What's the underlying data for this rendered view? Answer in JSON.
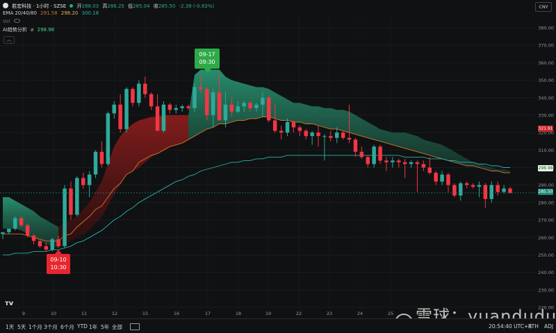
{
  "header": {
    "symbol_name": "胜宏科技 · 1小时 · SZSE",
    "open_label": "开",
    "open_value": "288.03",
    "high_label": "高",
    "high_value": "288.25",
    "low_label": "低",
    "low_value": "285.04",
    "close_label": "收",
    "close_value": "285.50",
    "change_value": "-2.38 (-0.83%)",
    "currency": "CNY"
  },
  "ema": {
    "label": "EMA 20/40/80",
    "v20": "291.58",
    "v40": "298.20",
    "v80": "300.18"
  },
  "vol_label": "Vol",
  "ai": {
    "label": "AI趋势分析",
    "value": "298.98"
  },
  "signals": [
    {
      "date": "09-17",
      "time": "09:30",
      "kind": "buy"
    },
    {
      "date": "09-10",
      "time": "10:30",
      "kind": "sell"
    }
  ],
  "price_badges": {
    "red": "321.91",
    "green": "298.98",
    "last": "285.50"
  },
  "bottom_bar": {
    "timeframes": [
      "1天",
      "5天",
      "1个月",
      "3个月",
      "6个月",
      "YTD",
      "1年",
      "5年",
      "全部"
    ],
    "time": "20:54:40 UTC+8",
    "session": "RTH",
    "adj": "ADJ"
  },
  "watermark": "雪球：yuandudu",
  "colors": {
    "up": "#2ea99a",
    "down": "#f23645",
    "ema20": "#d2772c",
    "ema80": "#26b3b0",
    "cloud_green": "#1f7a5f",
    "cloud_red": "#8a1d1d",
    "background": "#101112"
  },
  "chart_data": {
    "type": "candlestick",
    "x_tick_labels": [
      "9",
      "10",
      "11",
      "12",
      "15",
      "16",
      "17",
      "18",
      "19",
      "22",
      "23",
      "24",
      "25"
    ],
    "y_tick_labels": [
      "380.00",
      "370.00",
      "360.00",
      "350.00",
      "340.00",
      "330.00",
      "320.00",
      "310.00",
      "300.00",
      "290.00",
      "280.00",
      "270.00",
      "260.00",
      "250.00",
      "240.00",
      "230.00",
      "220.00"
    ],
    "ylim": [
      220,
      380
    ],
    "candles": [
      [
        262,
        263,
        259,
        263
      ],
      [
        263,
        265,
        262,
        265
      ],
      [
        265,
        272,
        264,
        271
      ],
      [
        271,
        272,
        266,
        267
      ],
      [
        267,
        268,
        260,
        261
      ],
      [
        261,
        262,
        256,
        258
      ],
      [
        258,
        258,
        254,
        255
      ],
      [
        255,
        257,
        252,
        253
      ],
      [
        253,
        260,
        252,
        259
      ],
      [
        259,
        261,
        254,
        255
      ],
      [
        255,
        290,
        254,
        288
      ],
      [
        288,
        292,
        270,
        273
      ],
      [
        273,
        295,
        272,
        294
      ],
      [
        294,
        297,
        288,
        290
      ],
      [
        290,
        298,
        283,
        296
      ],
      [
        296,
        310,
        294,
        309
      ],
      [
        309,
        315,
        300,
        302
      ],
      [
        302,
        332,
        301,
        331
      ],
      [
        331,
        338,
        328,
        336
      ],
      [
        336,
        342,
        320,
        322
      ],
      [
        322,
        346,
        320,
        345
      ],
      [
        345,
        346,
        335,
        337
      ],
      [
        337,
        350,
        335,
        348
      ],
      [
        348,
        352,
        340,
        342
      ],
      [
        342,
        343,
        333,
        335
      ],
      [
        335,
        342,
        321,
        321
      ],
      [
        321,
        338,
        320,
        336
      ],
      [
        336,
        337,
        331,
        333
      ],
      [
        333,
        336,
        331,
        334
      ],
      [
        334,
        336,
        332,
        335
      ],
      [
        335,
        336,
        333,
        334
      ],
      [
        334,
        348,
        332,
        346
      ],
      [
        346,
        353,
        343,
        345
      ],
      [
        345,
        346,
        327,
        330
      ],
      [
        330,
        345,
        323,
        343
      ],
      [
        343,
        353,
        327,
        327
      ],
      [
        327,
        343,
        323,
        336
      ],
      [
        336,
        340,
        329,
        332
      ],
      [
        332,
        338,
        331,
        335
      ],
      [
        335,
        338,
        332,
        337
      ],
      [
        337,
        338,
        332,
        334
      ],
      [
        334,
        337,
        332,
        336
      ],
      [
        336,
        343,
        329,
        340
      ],
      [
        340,
        341,
        326,
        327
      ],
      [
        327,
        336,
        320,
        321
      ],
      [
        321,
        324,
        316,
        320
      ],
      [
        320,
        328,
        318,
        326
      ],
      [
        326,
        327,
        320,
        323
      ],
      [
        323,
        324,
        318,
        321
      ],
      [
        321,
        322,
        316,
        318
      ],
      [
        318,
        321,
        313,
        320
      ],
      [
        320,
        324,
        312,
        318
      ],
      [
        318,
        319,
        304,
        318
      ],
      [
        318,
        321,
        315,
        317
      ],
      [
        317,
        323,
        314,
        320
      ],
      [
        320,
        321,
        316,
        317
      ],
      [
        317,
        336,
        314,
        316
      ],
      [
        316,
        317,
        306,
        309
      ],
      [
        309,
        312,
        305,
        306
      ],
      [
        306,
        307,
        300,
        302
      ],
      [
        302,
        313,
        300,
        312
      ],
      [
        312,
        313,
        302,
        304
      ],
      [
        304,
        306,
        298,
        303
      ],
      [
        303,
        306,
        300,
        304
      ],
      [
        304,
        305,
        300,
        303
      ],
      [
        303,
        305,
        294,
        302
      ],
      [
        302,
        304,
        300,
        303
      ],
      [
        303,
        304,
        286,
        302
      ],
      [
        302,
        304,
        298,
        300
      ],
      [
        300,
        306,
        296,
        297
      ],
      [
        297,
        298,
        290,
        292
      ],
      [
        292,
        298,
        290,
        296
      ],
      [
        296,
        297,
        286,
        290
      ],
      [
        290,
        291,
        283,
        284
      ],
      [
        284,
        292,
        281,
        291
      ],
      [
        291,
        292,
        288,
        290
      ],
      [
        290,
        291,
        288,
        289
      ],
      [
        289,
        292,
        283,
        290
      ],
      [
        290,
        291,
        277,
        282
      ],
      [
        282,
        292,
        280,
        290
      ],
      [
        290,
        292,
        284,
        286
      ],
      [
        286,
        290,
        285,
        288
      ],
      [
        288,
        289,
        285,
        285.5
      ]
    ],
    "ema20": [
      262,
      262,
      262,
      262,
      261,
      260,
      259,
      258,
      258,
      258,
      261,
      262,
      266,
      269,
      272,
      276,
      278,
      283,
      288,
      291,
      296,
      298,
      303,
      305,
      307,
      308,
      310,
      312,
      313,
      314,
      316,
      318,
      320,
      322,
      323,
      325,
      325,
      326,
      327,
      327,
      328,
      328,
      329,
      329,
      328,
      327,
      327,
      326,
      326,
      325,
      325,
      324,
      323,
      322,
      322,
      321,
      320,
      319,
      318,
      317,
      316,
      315,
      314,
      313,
      312,
      311,
      310,
      309,
      308,
      307,
      306,
      305,
      304,
      303,
      302,
      301,
      301,
      300,
      299,
      298,
      298,
      297,
      297
    ],
    "ema80": [
      250,
      250,
      251,
      251,
      251,
      252,
      252,
      252,
      253,
      253,
      254,
      255,
      257,
      258,
      260,
      262,
      264,
      267,
      270,
      272,
      275,
      277,
      280,
      282,
      284,
      286,
      288,
      290,
      292,
      293,
      295,
      296,
      298,
      299,
      300,
      301,
      302,
      303,
      303,
      304,
      304,
      305,
      305,
      306,
      306,
      306,
      307,
      307,
      307,
      307,
      307,
      307,
      307,
      307,
      307,
      307,
      307,
      307,
      307,
      307,
      307,
      307,
      307,
      307,
      307,
      306,
      306,
      306,
      306,
      305,
      305,
      305,
      304,
      304,
      303,
      303,
      303,
      302,
      302,
      301,
      301,
      300,
      300
    ],
    "cloud_upper": [
      283,
      283,
      281,
      279,
      277,
      275,
      272,
      270,
      268,
      266,
      268,
      270,
      272,
      276,
      280,
      286,
      292,
      302,
      312,
      318,
      322,
      325,
      327,
      328,
      329,
      329,
      330,
      330,
      330,
      330,
      330,
      353,
      356,
      356,
      356,
      356,
      352,
      350,
      349,
      348,
      347,
      346,
      346,
      345,
      343,
      341,
      339,
      337,
      337,
      336,
      335,
      335,
      334,
      334,
      333,
      333,
      332,
      330,
      328,
      326,
      324,
      322,
      321,
      320,
      320,
      320,
      319,
      318,
      316,
      315,
      314,
      313,
      311,
      309,
      307,
      305,
      303,
      302,
      301,
      300,
      299,
      299,
      298
    ],
    "cloud_lower": [
      265,
      265,
      265,
      264,
      262,
      260,
      258,
      256,
      255,
      254,
      256,
      258,
      260,
      262,
      264,
      268,
      272,
      278,
      285,
      290,
      296,
      298,
      300,
      303,
      306,
      308,
      310,
      312,
      313,
      314,
      316,
      318,
      320,
      322,
      323,
      325,
      325,
      326,
      327,
      327,
      328,
      328,
      329,
      329,
      328,
      327,
      327,
      326,
      326,
      325,
      325,
      324,
      323,
      322,
      322,
      321,
      320,
      319,
      318,
      317,
      316,
      315,
      314,
      313,
      312,
      311,
      310,
      309,
      308,
      307,
      306,
      305,
      304,
      303,
      302,
      301,
      301,
      300,
      299,
      298,
      298,
      297,
      297
    ]
  }
}
